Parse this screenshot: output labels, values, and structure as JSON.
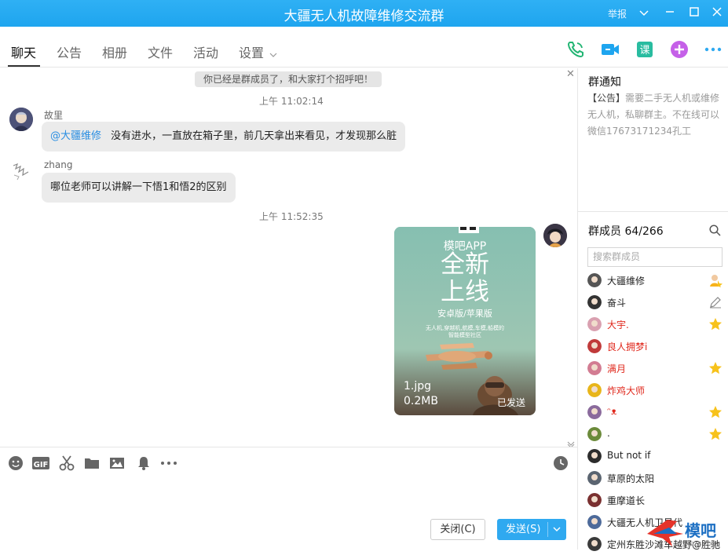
{
  "window": {
    "title": "大疆无人机故障维修交流群",
    "report_label": "举报"
  },
  "tabs": [
    {
      "label": "聊天"
    },
    {
      "label": "公告"
    },
    {
      "label": "相册"
    },
    {
      "label": "文件"
    },
    {
      "label": "活动"
    },
    {
      "label": "设置"
    }
  ],
  "header_actions": [
    "phone-icon",
    "video-icon",
    "course-icon",
    "add-app-icon",
    "more-icon"
  ],
  "chat": {
    "system_tip": "你已经是群成员了，和大家打个招呼吧！",
    "time1": "上午 11:02:14",
    "msg1": {
      "sender": "故里",
      "mention": "@大疆维修",
      "text": "没有进水，一直放在箱子里，前几天拿出来看见，才发现那么脏"
    },
    "msg2": {
      "sender": "zhang",
      "text": "哪位老师可以讲解一下悟1和悟2的区别"
    },
    "time2": "上午 11:52:35",
    "image_msg": {
      "app_name": "模吧APP",
      "headline1": "全新",
      "headline2": "上线",
      "platforms": "安卓版/苹果版",
      "tagline1": "无人机,穿越机,航模,车模,船模的",
      "tagline2": "智能模型社区",
      "file_name": "1.jpg",
      "file_size": "0.2MB",
      "status": "已发送"
    }
  },
  "toolbar": [
    "emoji-icon",
    "gif-icon",
    "scissors-icon",
    "folder-icon",
    "image-icon",
    "bell-icon",
    "more-icon",
    "history-icon"
  ],
  "buttons": {
    "close_label": "关闭(C)",
    "send_label": "发送(S)"
  },
  "notice": {
    "title": "群通知",
    "tag": "【公告】",
    "body": "需要二手无人机或维修无人机，私聊群主。不在线可以微信17673171234孔工"
  },
  "members": {
    "title": "群成员 64/266",
    "search_placeholder": "搜索群成员",
    "list": [
      {
        "name": "大疆维修",
        "color": "#222222",
        "role": "owner"
      },
      {
        "name": "奋斗",
        "color": "#222222",
        "role": "edit"
      },
      {
        "name": "大宇.",
        "color": "#e0281c",
        "role": "star"
      },
      {
        "name": "良人拥梦i",
        "color": "#e0281c",
        "role": ""
      },
      {
        "name": "满月",
        "color": "#e0281c",
        "role": "star"
      },
      {
        "name": "炸鸡大师",
        "color": "#e0281c",
        "role": ""
      },
      {
        "name": "ᵔᴥ",
        "color": "#e0281c",
        "role": "star"
      },
      {
        "name": ".",
        "color": "#222222",
        "role": "star"
      },
      {
        "name": "But not if",
        "color": "#222222",
        "role": ""
      },
      {
        "name": "草原的太阳",
        "color": "#222222",
        "role": ""
      },
      {
        "name": "重摩道长",
        "color": "#222222",
        "role": ""
      },
      {
        "name": "大疆无人机卫星代",
        "color": "#222222",
        "role": ""
      },
      {
        "name": "定州东胜沙滩车越野@胜驰",
        "color": "#222222",
        "role": ""
      }
    ]
  },
  "watermark": {
    "text": "模吧",
    "sub": "MOZB.COM"
  }
}
